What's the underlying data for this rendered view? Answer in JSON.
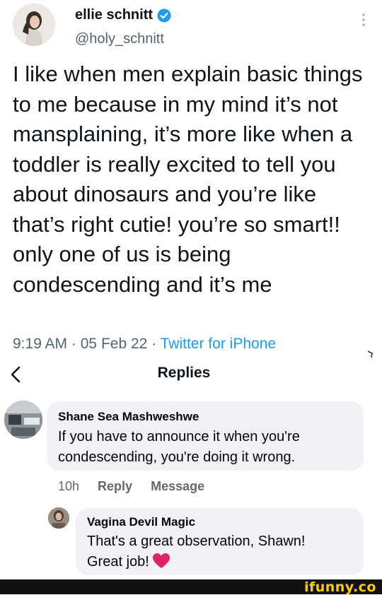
{
  "tweet": {
    "display_name": "ellie schnitt",
    "handle": "@holy_schnitt",
    "text": "I like when men explain basic things to me because in my mind it’s not mansplaining, it’s more like when a toddler is really excited to tell you about dinosaurs and you’re like that’s right cutie! you’re so smart!! only one of us is being condescending and it’s me",
    "time": "9:19 AM",
    "date": "05 Feb 22",
    "client": "Twitter for iPhone",
    "separator": "·"
  },
  "replies_header": {
    "title": "Replies"
  },
  "comments": [
    {
      "author": "Shane Sea Mashweshwe",
      "text": "If you have to announce it when you're condescending, you're doing it wrong.",
      "age": "10h",
      "reply_label": "Reply",
      "message_label": "Message"
    },
    {
      "author": "Vagina Devil Magic",
      "text_line1": "That's a great observation, Shawn!",
      "text_line2": "Great job!"
    }
  ],
  "watermark": "ifunny.co",
  "colors": {
    "link_blue": "#1d9bf0",
    "verified_blue": "#1d9bf0",
    "bubble_gray": "#f0f2f5",
    "heart_red": "#e0245e"
  }
}
